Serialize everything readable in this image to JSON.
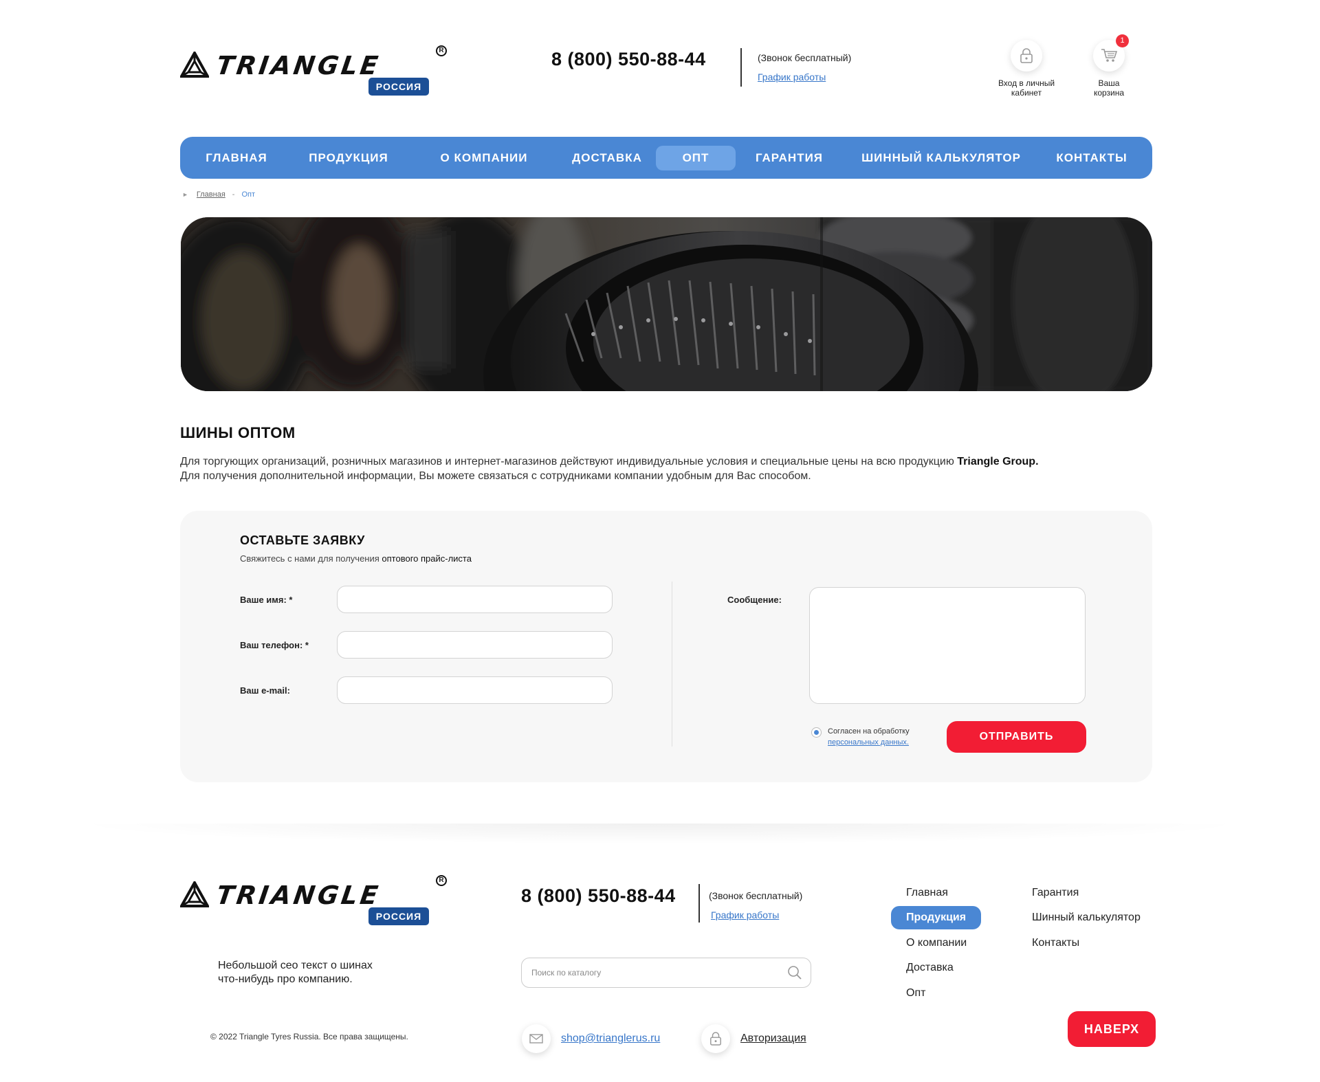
{
  "header": {
    "logo_word": "TRIANGLE",
    "logo_badge": "РОССИЯ",
    "phone": "8 (800) 550-88-44",
    "free_call": "(Звонок бесплатный)",
    "schedule_link": "График работы",
    "login_label_1": "Вход в личный",
    "login_label_2": "кабинет",
    "cart_label_1": "Ваша",
    "cart_label_2": "корзина",
    "cart_count": "1"
  },
  "nav": {
    "items": [
      {
        "label": "ГЛАВНАЯ"
      },
      {
        "label": "ПРОДУКЦИЯ"
      },
      {
        "label": "О КОМПАНИИ"
      },
      {
        "label": "ДОСТАВКА"
      },
      {
        "label": "ОПТ"
      },
      {
        "label": "ГАРАНТИЯ"
      },
      {
        "label": "ШИННЫЙ КАЛЬКУЛЯТОР"
      },
      {
        "label": "КОНТАКТЫ"
      }
    ],
    "active": "ОПТ"
  },
  "breadcrumb": {
    "home": "Главная",
    "separator": "-",
    "current": "Опт"
  },
  "content": {
    "title": "ШИНЫ ОПТОМ",
    "intro_line1_a": "Для торгующих организаций, розничных магазинов и интернет-магазинов действуют индивидуальные условия и специальные цены на всю продукцию ",
    "intro_line1_b": "Triangle Group.",
    "intro_line2": "Для получения дополнительной информации, Вы можете связаться с сотрудниками компании удобным для Вас способом."
  },
  "form": {
    "title": "ОСТАВЬТЕ ЗАЯВКУ",
    "subtitle_a": "Свяжитесь с нами для получения ",
    "subtitle_b": "оптового прайс-листа",
    "name_label": "Ваше имя: *",
    "phone_label": "Ваш телефон: *",
    "email_label": "Ваш e-mail:",
    "message_label": "Сообщение:",
    "name_value": "",
    "phone_value": "",
    "email_value": "",
    "message_value": "",
    "consent_text": "Согласен на обработку",
    "consent_link": "персональных данных.",
    "consent_checked": true,
    "submit_label": "ОТПРАВИТЬ"
  },
  "footer": {
    "logo_word": "TRIANGLE",
    "logo_badge": "РОССИЯ",
    "phone": "8 (800) 550-88-44",
    "free_call": "(Звонок бесплатный)",
    "schedule_link": "График работы",
    "seo_line1": "Небольшой сео текст о шинах",
    "seo_line2": "что-нибудь про компанию.",
    "search_placeholder": "Поиск по каталогу",
    "copyright": "© 2022 Triangle Tyres Russia. Все права защищены.",
    "email": "shop@trianglerus.ru",
    "auth": "Авторизация",
    "menu_col1": [
      "Главная",
      "Продукция",
      "О компании",
      "Доставка",
      "Опт"
    ],
    "menu_col2": [
      "Гарантия",
      "Шинный калькулятор",
      "Контакты"
    ],
    "menu_active": "Продукция",
    "top_button": "НАВЕРХ"
  },
  "icons": {
    "logo": "triangle-logo-icon",
    "login": "lock-icon",
    "cart": "cart-icon",
    "search": "search-icon",
    "email": "envelope-icon",
    "auth": "lock-icon",
    "breadcrumb": "triangle-arrow-icon"
  },
  "colors": {
    "primary": "#4a87d4",
    "nav_active": "#6ea4e6",
    "badge": "#1c4f96",
    "accent_red": "#f21d34",
    "link": "#3776c9",
    "form_bg": "#f7f7f7"
  }
}
